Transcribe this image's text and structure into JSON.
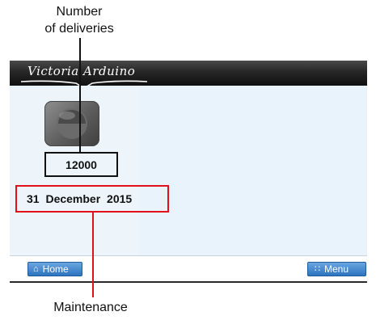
{
  "callouts": {
    "deliveries_line1": "Number",
    "deliveries_line2": "of deliveries",
    "maintenance": "Maintenance"
  },
  "header": {
    "logo_text": "Victoria Arduino"
  },
  "main": {
    "app_icon": "coffee-machine-icon",
    "deliveries_count": "12000",
    "maintenance_date": "31 December 2015"
  },
  "bottombar": {
    "home_label": "Home",
    "home_icon": "home-icon",
    "menu_label": "Menu",
    "menu_icon": "grid-icon"
  },
  "colors": {
    "maintenance_highlight": "#e2101a",
    "deliveries_highlight": "#111111",
    "button_blue": "#2d73bf",
    "content_bg": "#e9f3fb"
  }
}
